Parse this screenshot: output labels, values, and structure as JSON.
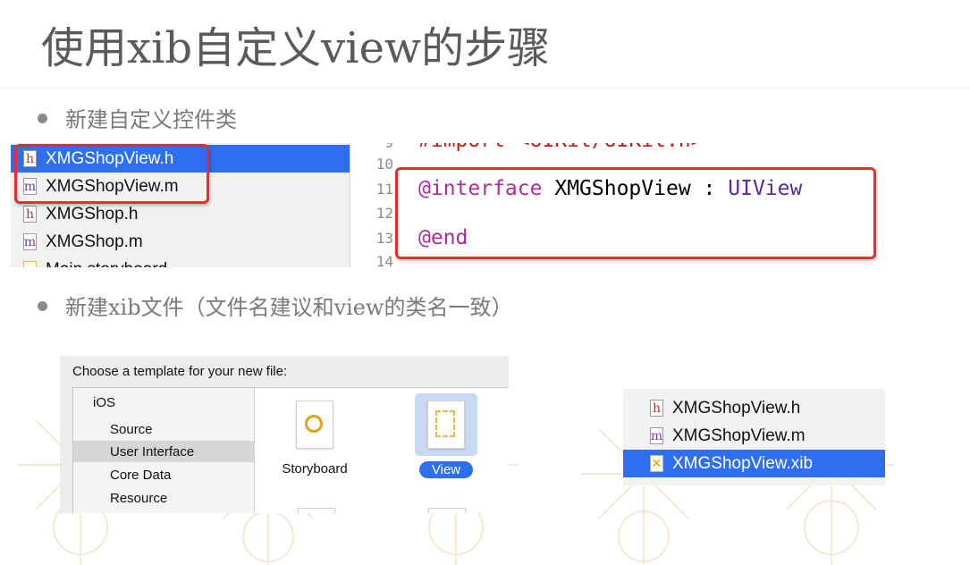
{
  "slide": {
    "title": "使用xib自定义view的步骤",
    "bullet1": "新建自定义控件类",
    "bullet2": "新建xib文件（文件名建议和view的类名一致）"
  },
  "file_list_1": {
    "items": [
      {
        "icon": "h",
        "name": "XMGShopView.h",
        "selected": true
      },
      {
        "icon": "m",
        "name": "XMGShopView.m",
        "selected": false
      },
      {
        "icon": "h",
        "name": "XMGShop.h",
        "selected": false
      },
      {
        "icon": "m",
        "name": "XMGShop.m",
        "selected": false
      },
      {
        "icon": "storyboard",
        "name": "Main.storyboard",
        "selected": false
      }
    ]
  },
  "code_editor": {
    "line_numbers": [
      "9",
      "10",
      "11",
      "12",
      "13",
      "14"
    ],
    "import_line": "#import <UIKit/UIKit.h>",
    "interface_keyword": "@interface",
    "class_name": "XMGShopView",
    "colon": ":",
    "superclass": "UIView",
    "end_keyword": "@end"
  },
  "template_dialog": {
    "header": "Choose a template for your new file:",
    "platform": "iOS",
    "categories": [
      "Source",
      "User Interface",
      "Core Data",
      "Resource"
    ],
    "selected_category": "User Interface",
    "templates": [
      "Storyboard",
      "View"
    ],
    "selected_template": "View"
  },
  "file_list_2": {
    "items": [
      {
        "icon": "h",
        "name": "XMGShopView.h",
        "selected": false
      },
      {
        "icon": "m",
        "name": "XMGShopView.m",
        "selected": false
      },
      {
        "icon": "xib",
        "name": "XMGShopView.xib",
        "selected": true
      }
    ]
  },
  "colors": {
    "highlight_red": "#ee2b2b",
    "selection_blue": "#2e6ff0",
    "keyword_purple": "#b3289f",
    "type_purple": "#5c2699"
  }
}
